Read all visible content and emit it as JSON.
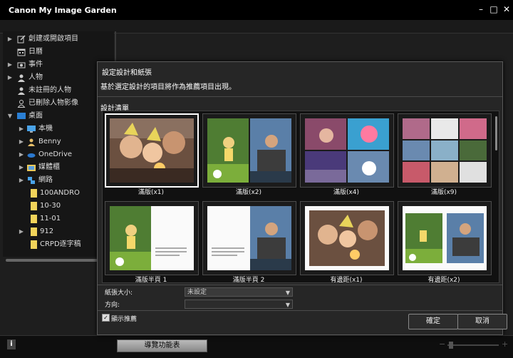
{
  "app": {
    "title": "Canon My Image Garden"
  },
  "window_controls": {
    "minimize": "–",
    "maximize": "□",
    "close": "✕"
  },
  "sidebar": {
    "items": [
      {
        "label": "創建或開啟項目",
        "icon": "create-edit-icon",
        "arrow": "▶"
      },
      {
        "label": "日曆",
        "icon": "calendar-icon",
        "arrow": ""
      },
      {
        "label": "事件",
        "icon": "event-icon",
        "arrow": "▶"
      },
      {
        "label": "人物",
        "icon": "person-icon",
        "arrow": "▶"
      },
      {
        "label": "未註冊的人物",
        "icon": "person-unregistered-icon",
        "arrow": ""
      },
      {
        "label": "已刪除人物影像",
        "icon": "person-deleted-icon",
        "arrow": ""
      },
      {
        "label": "桌面",
        "icon": "desktop-icon",
        "arrow": "▼"
      },
      {
        "label": "本機",
        "icon": "computer-icon",
        "arrow": "▶"
      },
      {
        "label": "Benny",
        "icon": "user-folder-icon",
        "arrow": "▶"
      },
      {
        "label": "OneDrive",
        "icon": "onedrive-icon",
        "arrow": "▶"
      },
      {
        "label": "媒體櫃",
        "icon": "library-icon",
        "arrow": "▶"
      },
      {
        "label": "網路",
        "icon": "network-icon",
        "arrow": "▶"
      },
      {
        "label": "100ANDRO",
        "icon": "folder-icon",
        "arrow": ""
      },
      {
        "label": "10-30",
        "icon": "folder-icon",
        "arrow": ""
      },
      {
        "label": "11-01",
        "icon": "folder-icon",
        "arrow": ""
      },
      {
        "label": "912",
        "icon": "folder-icon",
        "arrow": "▶"
      },
      {
        "label": "CRPD逐字稿",
        "icon": "folder-icon",
        "arrow": ""
      }
    ]
  },
  "bottom": {
    "info_label": "i",
    "guide_button": "導覽功能表",
    "zoom_minus": "−",
    "zoom_plus": "+"
  },
  "dialog": {
    "title": "設定設計和紙張",
    "instruction": "基於選定設計的項目將作為推薦項目出現。",
    "section_label": "設計清單",
    "designs": [
      {
        "label": "滿版(x1)"
      },
      {
        "label": "滿版(x2)"
      },
      {
        "label": "滿版(x4)"
      },
      {
        "label": "滿版(x9)"
      },
      {
        "label": "滿版半頁 1"
      },
      {
        "label": "滿版半頁 2"
      },
      {
        "label": "有邊距(x1)"
      },
      {
        "label": "有邊距(x2)"
      }
    ],
    "paper_size_label": "紙張大小:",
    "paper_size_value": "未設定",
    "orientation_label": "方向:",
    "orientation_value": "",
    "show_recommend_label": "顯示推薦",
    "show_recommend_checked": "✓",
    "ok_button": "確定",
    "cancel_button": "取消"
  },
  "colors": {
    "accent": "#ffffff",
    "folder": "#f1d35a",
    "desktop": "#2a7fd4"
  }
}
